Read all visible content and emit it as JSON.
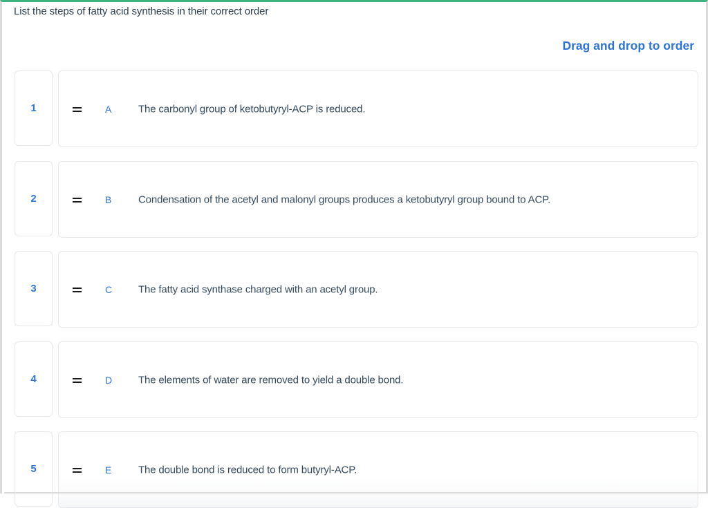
{
  "question": {
    "title": "List the steps of fatty acid synthesis in their correct order",
    "instruction": "Drag and drop to order"
  },
  "colors": {
    "accent": "#2d74da",
    "top_border": "#3fb27f",
    "text": "#34495e"
  },
  "items": [
    {
      "position": "1",
      "letter": "A",
      "text": "The carbonyl group of ketobutyryl-ACP is reduced.",
      "icon": "drag-handle-icon"
    },
    {
      "position": "2",
      "letter": "B",
      "text": "Condensation of the acetyl and malonyl groups produces a ketobutyryl group bound to ACP.",
      "icon": "drag-handle-icon"
    },
    {
      "position": "3",
      "letter": "C",
      "text": "The fatty acid synthase charged with an acetyl group.",
      "icon": "drag-handle-icon"
    },
    {
      "position": "4",
      "letter": "D",
      "text": "The elements of water are removed to yield a double bond.",
      "icon": "drag-handle-icon"
    },
    {
      "position": "5",
      "letter": "E",
      "text": "The double bond is reduced to form butyryl-ACP.",
      "icon": "drag-handle-icon"
    }
  ]
}
